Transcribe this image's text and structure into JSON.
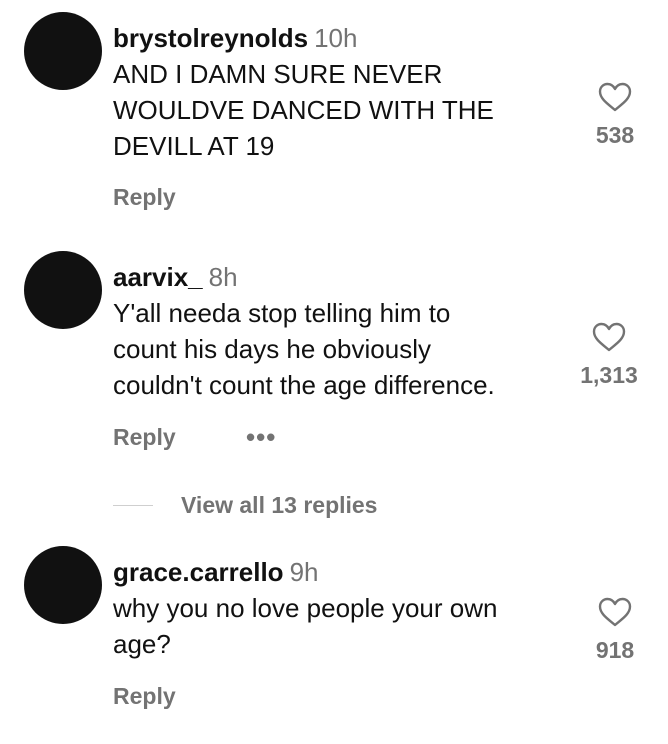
{
  "comments": [
    {
      "username": "brystolreynolds",
      "time": "10h",
      "text_lines": [
        "AND I DAMN SURE NEVER",
        "WOULDVE DANCED WITH THE",
        "DEVILL AT 19"
      ],
      "likes": "538",
      "reply_label": "Reply"
    },
    {
      "username": "aarvix_",
      "time": "8h",
      "text_lines": [
        "Y'all needa stop telling him to",
        "count his days he obviously",
        "couldn't count the age difference."
      ],
      "likes": "1,313",
      "reply_label": "Reply",
      "more_label": "•••"
    },
    {
      "username": "grace.carrello",
      "time": "9h",
      "text_lines": [
        "why you no love people your own",
        "age?"
      ],
      "likes": "918",
      "reply_label": "Reply"
    }
  ],
  "view_replies_label": "View all 13 replies",
  "colors": {
    "text": "#111111",
    "muted": "#737373",
    "avatar": "#111111",
    "heart_outline": "#737373"
  },
  "icons": {
    "like": "heart-outline-icon",
    "more": "more-horizontal-icon"
  }
}
